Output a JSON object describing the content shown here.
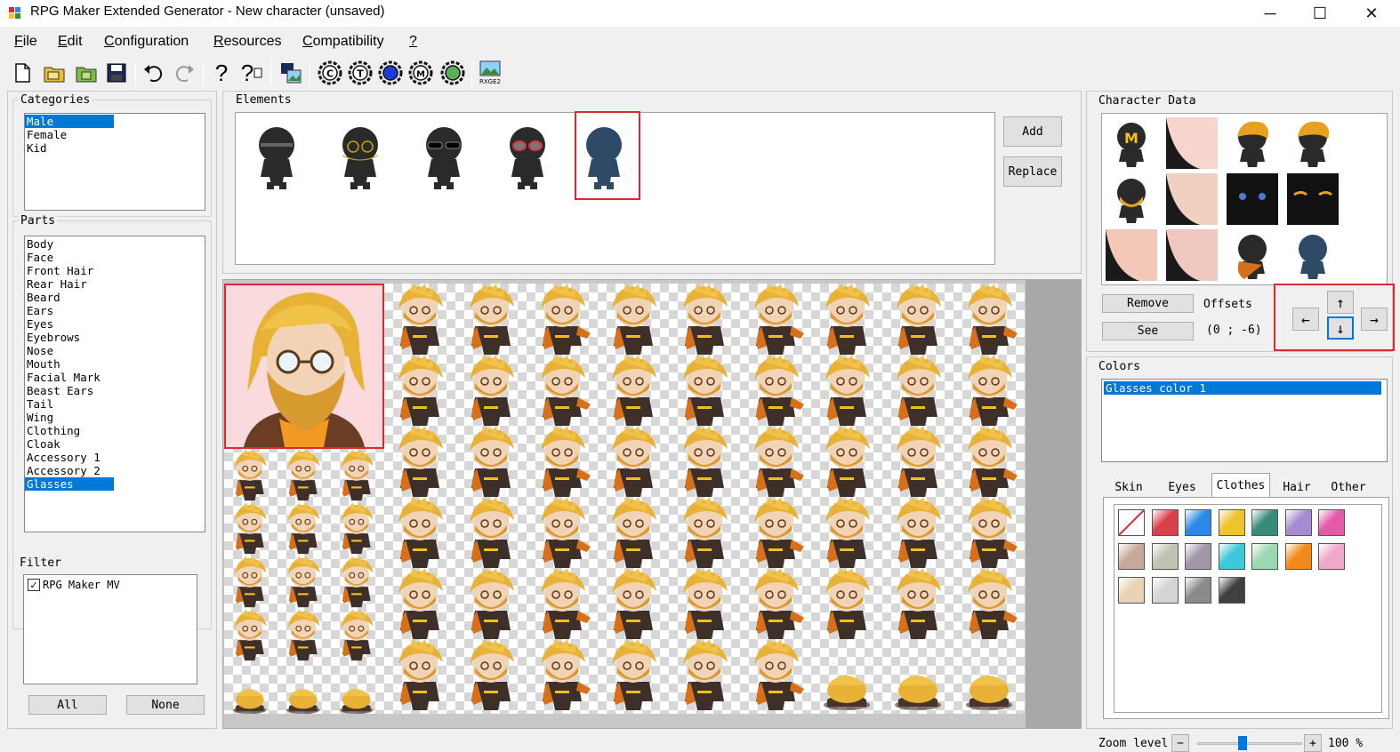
{
  "window": {
    "title": "RPG Maker Extended Generator - New character (unsaved)",
    "minimize_glyph": "─",
    "maximize_glyph": "☐",
    "close_glyph": "✕"
  },
  "menu": [
    {
      "label": "File",
      "accel": "F",
      "rest": "ile"
    },
    {
      "label": "Edit",
      "accel": "E",
      "rest": "dit"
    },
    {
      "label": "Configuration",
      "accel": "C",
      "rest": "onfiguration"
    },
    {
      "label": "Resources",
      "accel": "R",
      "rest": "esources"
    },
    {
      "label": "Compatibility",
      "accel": "C",
      "rest": "ompatibility"
    },
    {
      "label": "?",
      "accel": "?",
      "rest": ""
    }
  ],
  "toolbar": {
    "help_glyph": "?",
    "help_ctx_glyph": "?",
    "badge_c": "C",
    "badge_t": "T",
    "badge_m": "M",
    "rxge_label": "RXGE2"
  },
  "categories": {
    "label": "Categories",
    "items": [
      "Male",
      "Female",
      "Kid"
    ],
    "selected": "Male"
  },
  "parts": {
    "label": "Parts",
    "items": [
      "Body",
      "Face",
      "Front Hair",
      "Rear Hair",
      "Beard",
      "Ears",
      "Eyes",
      "Eyebrows",
      "Nose",
      "Mouth",
      "Facial Mark",
      "Beast Ears",
      "Tail",
      "Wing",
      "Clothing",
      "Cloak",
      "Accessory 1",
      "Accessory 2",
      "Glasses"
    ],
    "selected": "Glasses"
  },
  "filter": {
    "label": "Filter",
    "items": [
      {
        "label": "RPG Maker MV",
        "checked": true
      }
    ],
    "check_glyph": "✓",
    "all_button": "All",
    "none_button": "None"
  },
  "elements": {
    "label": "Elements",
    "add_button": "Add",
    "replace_button": "Replace",
    "items": [
      {
        "name": "plain"
      },
      {
        "name": "gold-glasses"
      },
      {
        "name": "sunglasses"
      },
      {
        "name": "red-glasses"
      },
      {
        "name": "blue-figure",
        "selected": true
      }
    ]
  },
  "character_data": {
    "label": "Character Data",
    "remove_button": "Remove",
    "see_button": "See",
    "offsets_label": "Offsets",
    "offsets_value": "(0 ; -6)",
    "arrows": {
      "up": "↑",
      "left": "←",
      "down": "↓",
      "right": "→"
    },
    "thumb_badge": "M"
  },
  "colors": {
    "label": "Colors",
    "items": [
      "Glasses color 1"
    ],
    "selected": "Glasses color 1",
    "tabs": [
      "Skin",
      "Eyes",
      "Clothes",
      "Hair",
      "Other"
    ],
    "active_tab": "Clothes",
    "palette": [
      [
        "none",
        "#d9404a",
        "#2b8ae8",
        "#f0c22c",
        "#3a8a7a",
        "#a78bd0",
        "#e55aa8"
      ],
      [
        "#c8a89a",
        "#bfc3b0",
        "#a296a8",
        "#3ec9d9",
        "#9ad8b0",
        "#f08a1a",
        "#f0a8c8"
      ],
      [
        "#e8d4b4",
        "#d4d4d4",
        "#8a8a8a",
        "#404040"
      ]
    ]
  },
  "status": {
    "zoom_label": "Zoom level",
    "zoom_minus": "−",
    "zoom_plus": "+",
    "zoom_value": "100 %",
    "zoom_fraction": 0.42
  }
}
